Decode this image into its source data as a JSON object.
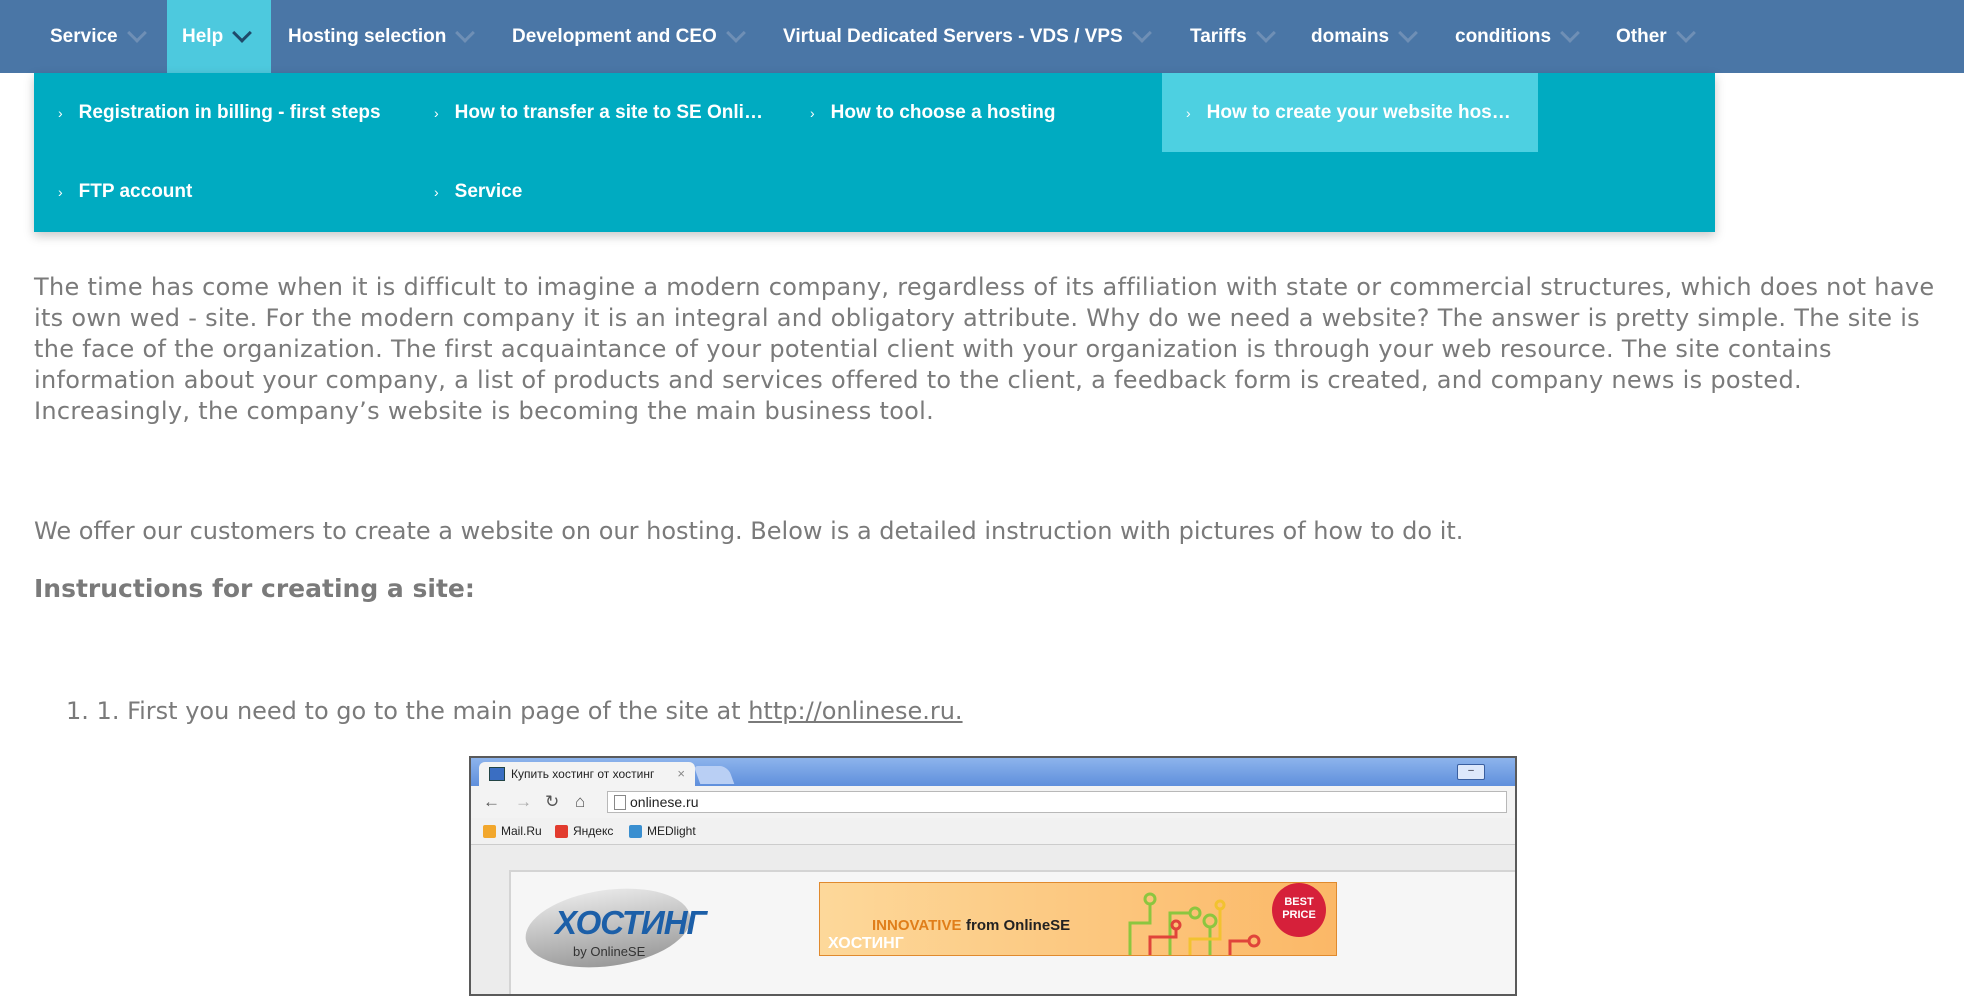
{
  "nav": {
    "items": [
      {
        "label": "Service",
        "active": false
      },
      {
        "label": "Help",
        "active": true
      },
      {
        "label": "Hosting selection",
        "active": false
      },
      {
        "label": "Development and CEO",
        "active": false
      },
      {
        "label": "Virtual Dedicated Servers - VDS / VPS",
        "active": false
      },
      {
        "label": "Tariffs",
        "active": false
      },
      {
        "label": "domains",
        "active": false
      },
      {
        "label": "conditions",
        "active": false
      },
      {
        "label": "Other",
        "active": false
      }
    ]
  },
  "dropdown": {
    "items": [
      {
        "label": "Registration in billing - first steps",
        "active": false
      },
      {
        "label": "How to transfer a site to SE Onli…",
        "active": false
      },
      {
        "label": "How to choose a hosting",
        "active": false
      },
      {
        "label": "How to create your website hos…",
        "active": true
      },
      {
        "label": "FTP account",
        "active": false
      },
      {
        "label": "Service",
        "active": false
      }
    ]
  },
  "content": {
    "paragraph1": "The time has come when it is difficult to imagine a modern company, regardless of its affiliation with state or commercial structures, which does not have its own wed - site. For the modern company it is an integral and obligatory attribute. Why do we need a website? The answer is pretty simple. The site is the face of the organization. The first acquaintance of your potential client with your organization is through your web resource. The site contains information about your company, a list of products and services offered to the client, a feedback form is created, and company news is posted. Increasingly, the company’s website is becoming the main business tool.",
    "paragraph2": "We offer our customers to create a website on our hosting. Below is a detailed instruction with pictures of how to do it.",
    "heading": "Instructions for creating a site:",
    "step1_number": "1.",
    "step1_text": "1. First you need to go to the main page of the site at ",
    "step1_link": "http://onlinese.ru."
  },
  "screenshot": {
    "tab_title": "Купить хостинг от хостинг",
    "tab_close": "×",
    "url": "onlinese.ru",
    "bookmarks": [
      "Mail.Ru",
      "Яндекс",
      "MEDlight"
    ],
    "logo_text": "ХОСТИНГ",
    "logo_sub": "by OnlineSE",
    "banner_innovative": "INNOVATIVE",
    "banner_from": "from OnlineSE",
    "banner_hosting": "ХОСТИНГ",
    "badge": "BEST PRICE"
  },
  "colors": {
    "nav_bg": "#4a76a6",
    "nav_active": "#4dc9de",
    "dropdown_bg": "#00abc1",
    "dropdown_active": "#4dd0e1",
    "text": "#7a7a7a"
  }
}
